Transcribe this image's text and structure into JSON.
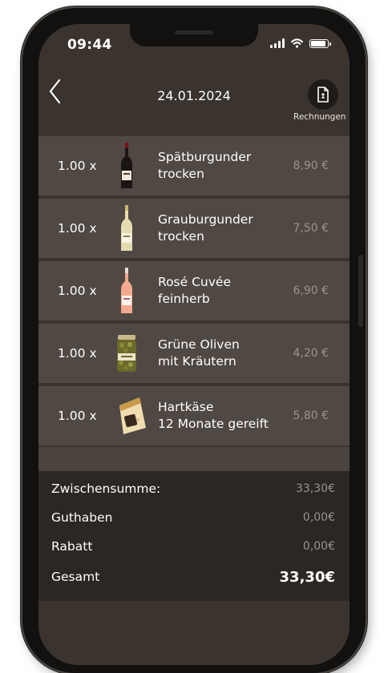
{
  "status_bar": {
    "time": "09:44"
  },
  "header": {
    "date": "24.01.2024",
    "invoice_label": "Rechnungen"
  },
  "items": [
    {
      "qty": "1.00 x",
      "name_line1": "Spätburgunder",
      "name_line2": "trocken",
      "price": "8,90 €",
      "thumb": "red-wine-bottle"
    },
    {
      "qty": "1.00 x",
      "name_line1": "Grauburgunder",
      "name_line2": "trocken",
      "price": "7,50 €",
      "thumb": "white-wine-bottle"
    },
    {
      "qty": "1.00 x",
      "name_line1": "Rosé Cuvée",
      "name_line2": "feinherb",
      "price": "6,90 €",
      "thumb": "rose-wine-bottle"
    },
    {
      "qty": "1.00 x",
      "name_line1": "Grüne Oliven",
      "name_line2": "mit Kräutern",
      "price": "4,20 €",
      "thumb": "olive-jar"
    },
    {
      "qty": "1.00 x",
      "name_line1": "Hartkäse",
      "name_line2": "12 Monate gereift",
      "price": "5,80 €",
      "thumb": "cheese-wedge"
    }
  ],
  "summary": {
    "subtotal_label": "Zwischensumme:",
    "subtotal_value": "33,30€",
    "credit_label": "Guthaben",
    "credit_value": "0,00€",
    "discount_label": "Rabatt",
    "discount_value": "0,00€",
    "total_label": "Gesamt",
    "total_value": "33,30€"
  },
  "colors": {
    "background": "#3a332e",
    "row": "#4f4843",
    "summary": "#2b2724",
    "muted_price": "#9b938d"
  }
}
